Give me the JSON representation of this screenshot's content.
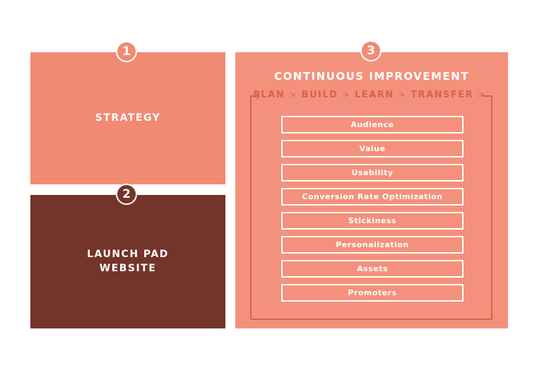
{
  "colors": {
    "strategy_fill": "#f18a73",
    "launchpad_fill": "#733429",
    "improvement_fill": "#f4917c",
    "cycle_text": "#d9624b",
    "label_text": "#ffffff"
  },
  "steps": [
    {
      "number": "1",
      "label": "STRATEGY"
    },
    {
      "number": "2",
      "label": "LAUNCH PAD WEBSITE"
    },
    {
      "number": "3",
      "label": "CONTINUOUS IMPROVEMENT"
    }
  ],
  "cycle": {
    "stages": [
      "PLAN",
      "BUILD",
      "LEARN",
      "TRANSFER"
    ],
    "separator": ">"
  },
  "improvement_items": [
    "Audience",
    "Value",
    "Usability",
    "Conversion Rate Optimization",
    "Stickiness",
    "Personalization",
    "Assets",
    "Promoters"
  ]
}
